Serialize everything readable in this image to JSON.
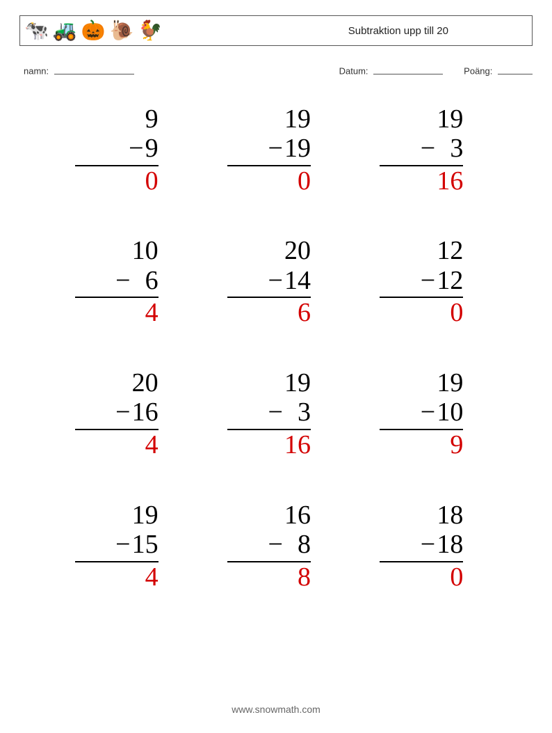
{
  "header": {
    "title": "Subtraktion upp till 20",
    "icons": [
      "🐄",
      "🚜",
      "🎃",
      "🐌",
      "🐓"
    ]
  },
  "meta": {
    "name_label": "namn:",
    "date_label": "Datum:",
    "score_label": "Poäng:"
  },
  "problems": [
    {
      "top": "9",
      "sub": "9",
      "answer": "0"
    },
    {
      "top": "19",
      "sub": "19",
      "answer": "0"
    },
    {
      "top": "19",
      "sub": "3",
      "answer": "16"
    },
    {
      "top": "10",
      "sub": "6",
      "answer": "4"
    },
    {
      "top": "20",
      "sub": "14",
      "answer": "6"
    },
    {
      "top": "12",
      "sub": "12",
      "answer": "0"
    },
    {
      "top": "20",
      "sub": "16",
      "answer": "4"
    },
    {
      "top": "19",
      "sub": "3",
      "answer": "16"
    },
    {
      "top": "19",
      "sub": "10",
      "answer": "9"
    },
    {
      "top": "19",
      "sub": "15",
      "answer": "4"
    },
    {
      "top": "16",
      "sub": "8",
      "answer": "8"
    },
    {
      "top": "18",
      "sub": "18",
      "answer": "0"
    }
  ],
  "footer": {
    "url": "www.snowmath.com"
  }
}
